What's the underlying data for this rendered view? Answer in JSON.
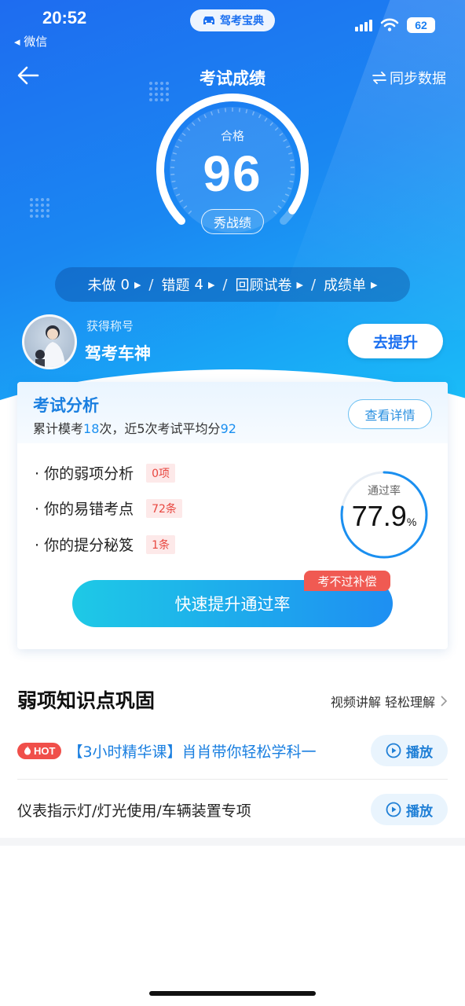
{
  "status_bar": {
    "time": "20:52",
    "back_app": "◂ 微信",
    "app_name": "驾考宝典",
    "battery": "62"
  },
  "nav": {
    "title": "考试成绩",
    "sync_label": "同步数据"
  },
  "score": {
    "status": "合格",
    "value": "96",
    "share_label": "秀战绩",
    "progress": 0.96
  },
  "quick_links": [
    {
      "label": "未做",
      "count": "0"
    },
    {
      "label": "错题",
      "count": "4"
    },
    {
      "label": "回顾试卷",
      "count": ""
    },
    {
      "label": "成绩单",
      "count": ""
    }
  ],
  "title_badge": {
    "label": "获得称号",
    "name": "驾考车神",
    "improve_label": "去提升"
  },
  "analysis": {
    "title": "考试分析",
    "sub_prefix": "累计模考",
    "mock_count": "18",
    "sub_mid": "次，近5次考试平均分",
    "avg_score": "92",
    "detail_label": "查看详情",
    "rows": [
      {
        "label": "· 你的弱项分析",
        "badge": "0项"
      },
      {
        "label": "· 你的易错考点",
        "badge": "72条"
      },
      {
        "label": "· 你的提分秘笈",
        "badge": "1条"
      }
    ],
    "pass_label": "通过率",
    "pass_value": "77.9",
    "pass_unit": "%",
    "pass_fraction": 0.779,
    "boost_label": "快速提升通过率",
    "refund_tag": "考不过补偿"
  },
  "weak_section": {
    "title": "弱项知识点巩固",
    "more_label": "视频讲解 轻松理解",
    "courses": [
      {
        "hot": "HOT",
        "title": "【3小时精华课】肖肖带你轻松学科一",
        "play": "播放"
      },
      {
        "hot": "",
        "title": "仪表指示灯/灯光使用/车辆装置专项",
        "play": "播放"
      }
    ]
  },
  "colors": {
    "accent": "#1a7ff2",
    "hot": "#f04f4a",
    "badge_text": "#e8463f"
  }
}
